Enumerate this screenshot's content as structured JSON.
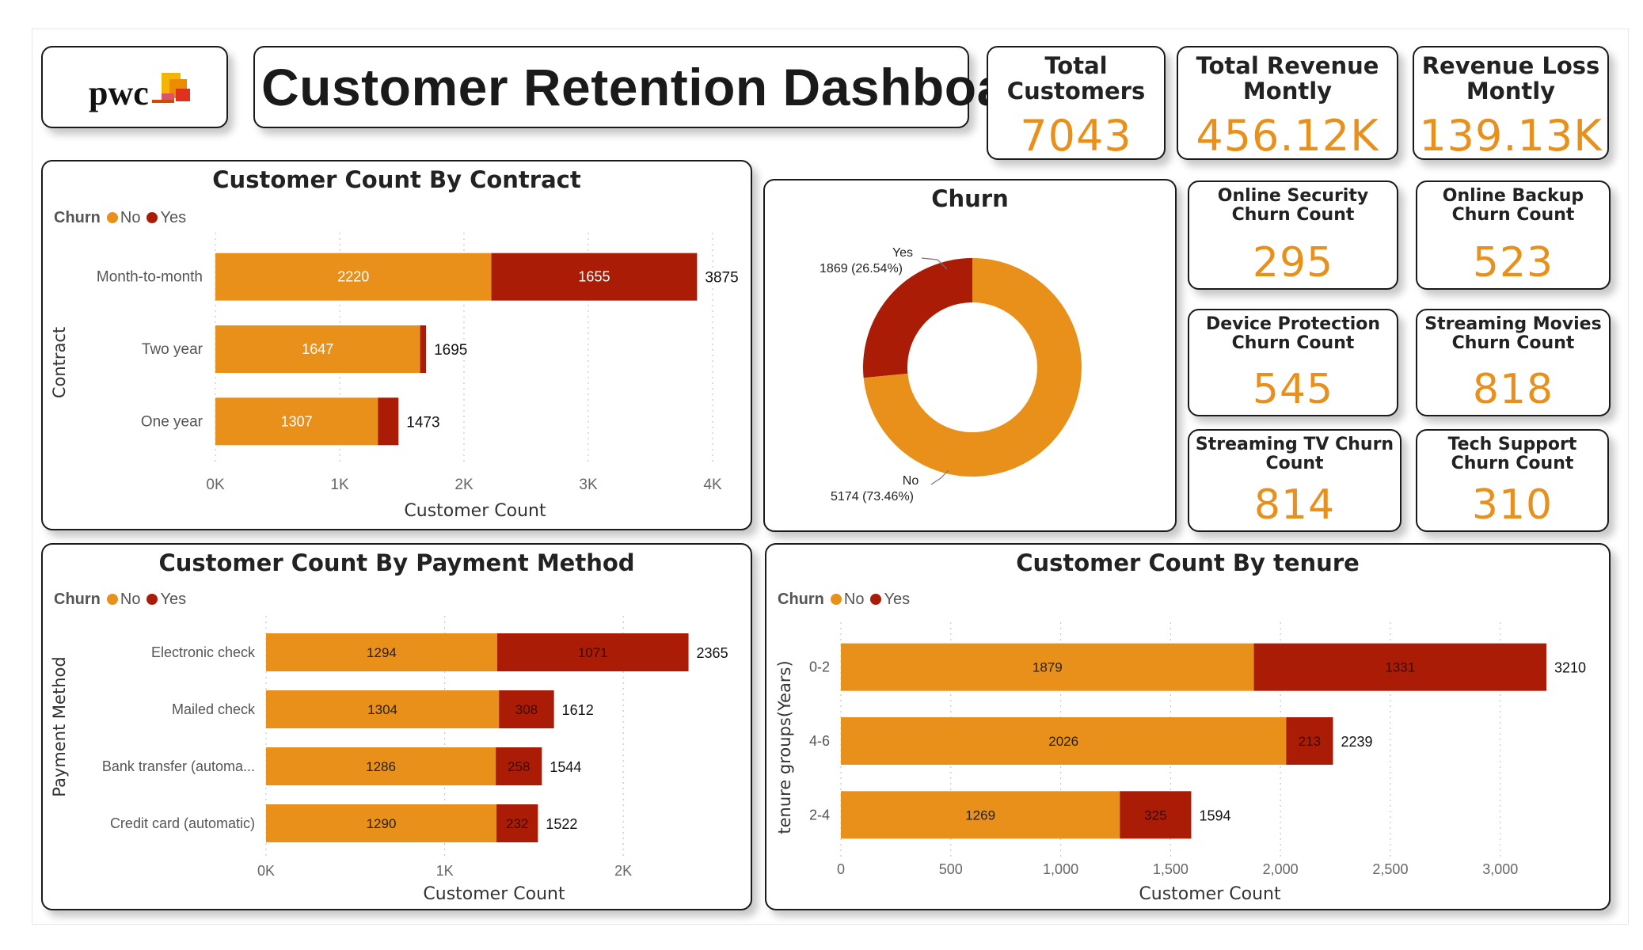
{
  "header": {
    "logo_text": "pwc",
    "title": "Customer Retention Dashboard"
  },
  "colors": {
    "no": "#E8901A",
    "yes": "#AB1C07",
    "accent": "#E8901A"
  },
  "kpis": {
    "total_customers": {
      "title": "Total Customers",
      "value": "7043"
    },
    "total_revenue": {
      "title": "Total Revenue Montly",
      "value": "456.12K"
    },
    "revenue_loss": {
      "title": "Revenue Loss Montly",
      "value": "139.13K"
    },
    "online_security": {
      "title": "Online Security Churn Count",
      "value": "295"
    },
    "online_backup": {
      "title": "Online Backup Churn Count",
      "value": "523"
    },
    "device_protection": {
      "title": "Device Protection Churn Count",
      "value": "545"
    },
    "streaming_movies": {
      "title": "Streaming Movies Churn Count",
      "value": "818"
    },
    "streaming_tv": {
      "title": "Streaming TV Churn Count",
      "value": "814"
    },
    "tech_support": {
      "title": "Tech Support Churn Count",
      "value": "310"
    }
  },
  "legend": {
    "title": "Churn",
    "no": "No",
    "yes": "Yes"
  },
  "chart_data": [
    {
      "type": "bar",
      "title": "Customer Count By Contract",
      "xlabel": "Customer Count",
      "ylabel": "Contract",
      "orientation": "horizontal",
      "stacked": true,
      "xlim": [
        0,
        4000
      ],
      "x_ticks": [
        "0K",
        "1K",
        "2K",
        "3K",
        "4K"
      ],
      "categories": [
        "Month-to-month",
        "Two year",
        "One year"
      ],
      "series": [
        {
          "name": "No",
          "values": [
            2220,
            1647,
            1307
          ],
          "labels": [
            "2220",
            "1647",
            "1307"
          ]
        },
        {
          "name": "Yes",
          "values": [
            1655,
            48,
            166
          ],
          "labels": [
            "1655",
            "",
            ""
          ]
        }
      ],
      "totals": [
        "3875",
        "1695",
        "1473"
      ]
    },
    {
      "type": "pie",
      "title": "Churn",
      "donut": true,
      "slices": [
        {
          "name": "Yes",
          "value": 1869,
          "label": "1869 (26.54%)"
        },
        {
          "name": "No",
          "value": 5174,
          "label": "5174 (73.46%)"
        }
      ]
    },
    {
      "type": "bar",
      "title": "Customer Count By Payment Method",
      "xlabel": "Customer Count",
      "ylabel": "Payment Method",
      "orientation": "horizontal",
      "stacked": true,
      "xlim": [
        0,
        2500
      ],
      "x_ticks": [
        "0K",
        "1K",
        "2K"
      ],
      "categories": [
        "Electronic check",
        "Mailed check",
        "Bank transfer (automa...",
        "Credit card (automatic)"
      ],
      "series": [
        {
          "name": "No",
          "values": [
            1294,
            1304,
            1286,
            1290
          ],
          "labels": [
            "1294",
            "1304",
            "1286",
            "1290"
          ]
        },
        {
          "name": "Yes",
          "values": [
            1071,
            308,
            258,
            232
          ],
          "labels": [
            "1071",
            "308",
            "258",
            "232"
          ]
        }
      ],
      "totals": [
        "2365",
        "1612",
        "1544",
        "1522"
      ]
    },
    {
      "type": "bar",
      "title": "Customer Count By tenure",
      "xlabel": "Customer Count",
      "ylabel": "tenure groups(Years)",
      "orientation": "horizontal",
      "stacked": true,
      "xlim": [
        0,
        3300
      ],
      "x_ticks": [
        "0",
        "500",
        "1,000",
        "1,500",
        "2,000",
        "2,500",
        "3,000"
      ],
      "categories": [
        "0-2",
        "4-6",
        "2-4"
      ],
      "series": [
        {
          "name": "No",
          "values": [
            1879,
            2026,
            1269
          ],
          "labels": [
            "1879",
            "2026",
            "1269"
          ]
        },
        {
          "name": "Yes",
          "values": [
            1331,
            213,
            325
          ],
          "labels": [
            "1331",
            "213",
            "325"
          ]
        }
      ],
      "totals": [
        "3210",
        "2239",
        "1594"
      ]
    }
  ]
}
